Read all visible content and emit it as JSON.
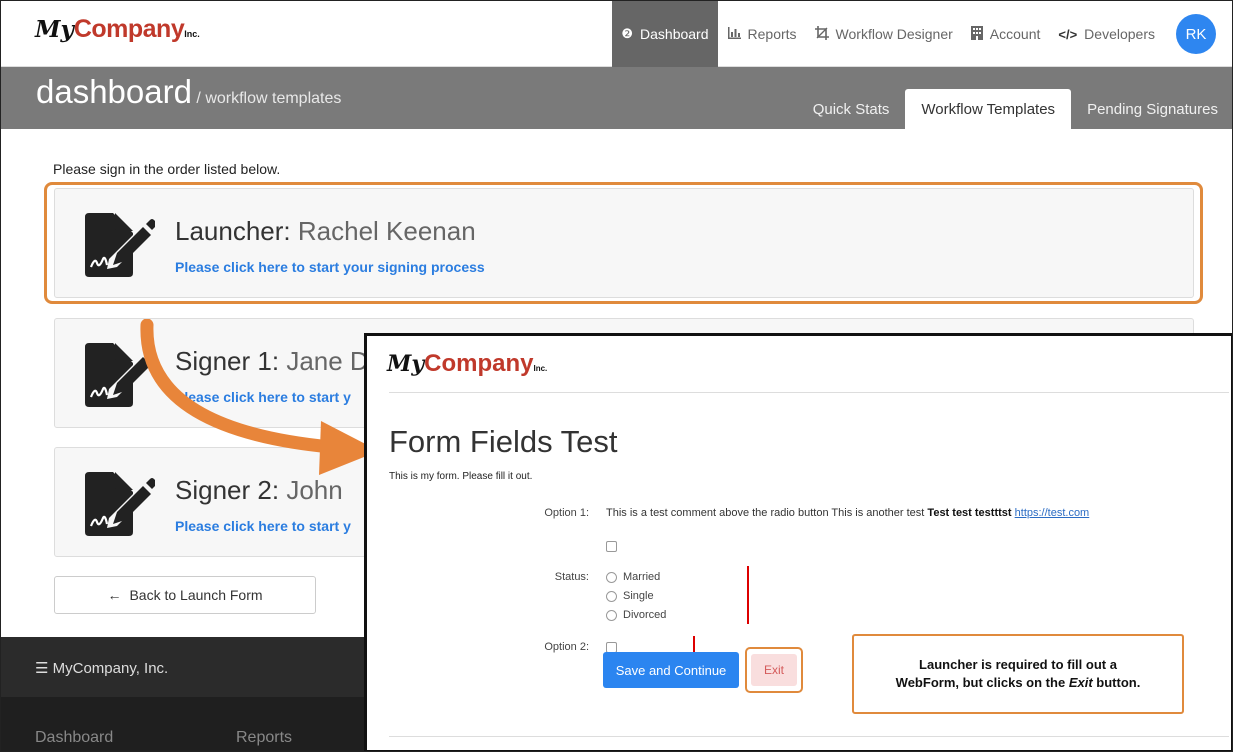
{
  "navbar": {
    "logo": {
      "my": "My",
      "company": "Company",
      "inc": "Inc."
    },
    "items": [
      {
        "label": "Dashboard",
        "icon": "dashboard-icon",
        "active": true
      },
      {
        "label": "Reports",
        "icon": "bar-chart-icon",
        "active": false
      },
      {
        "label": "Workflow Designer",
        "icon": "crop-icon",
        "active": false
      },
      {
        "label": "Account",
        "icon": "building-icon",
        "active": false
      },
      {
        "label": "Developers",
        "icon": "code-icon",
        "active": false
      }
    ],
    "avatar": "RK"
  },
  "header": {
    "title": "dashboard",
    "subtitle": "/ workflow templates",
    "tabs": [
      {
        "label": "Quick Stats",
        "active": false
      },
      {
        "label": "Workflow Templates",
        "active": true
      },
      {
        "label": "Pending Signatures",
        "active": false
      }
    ]
  },
  "main": {
    "instruction": "Please sign in the order listed below.",
    "signers": [
      {
        "role": "Launcher:",
        "name": "Rachel Keenan",
        "link": "Please click here to start your signing process"
      },
      {
        "role": "Signer 1:",
        "name": "Jane D",
        "link": "Please click here to start y"
      },
      {
        "role": "Signer 2:",
        "name": "John",
        "link": "Please click here to start y"
      }
    ],
    "back_button": "Back to Launch Form"
  },
  "footer": {
    "brand": "MyCompany, Inc.",
    "links": [
      "Dashboard",
      "Reports"
    ]
  },
  "overlay": {
    "logo": {
      "my": "My",
      "company": "Company",
      "inc": "Inc."
    },
    "title": "Form Fields Test",
    "description": "This is my form. Please fill it out.",
    "option1_label": "Option 1:",
    "option1_text": "This is a test comment above the radio button This is another test",
    "option1_bold": "Test test testttst",
    "option1_url": "https://test.com",
    "status_label": "Status:",
    "status_options": [
      "Married",
      "Single",
      "Divorced"
    ],
    "option2_label": "Option 2:",
    "save_button": "Save and Continue",
    "exit_button": "Exit"
  },
  "callout": {
    "line1": "Launcher is required to fill out a",
    "line2_pre": "WebForm, but clicks on the",
    "line2_em": "Exit",
    "line2_post": "button."
  },
  "colors": {
    "accent": "#2b85f0",
    "highlight": "#e08a3c",
    "brand_red": "#c0392b",
    "header_gray": "#7a7a7a"
  }
}
